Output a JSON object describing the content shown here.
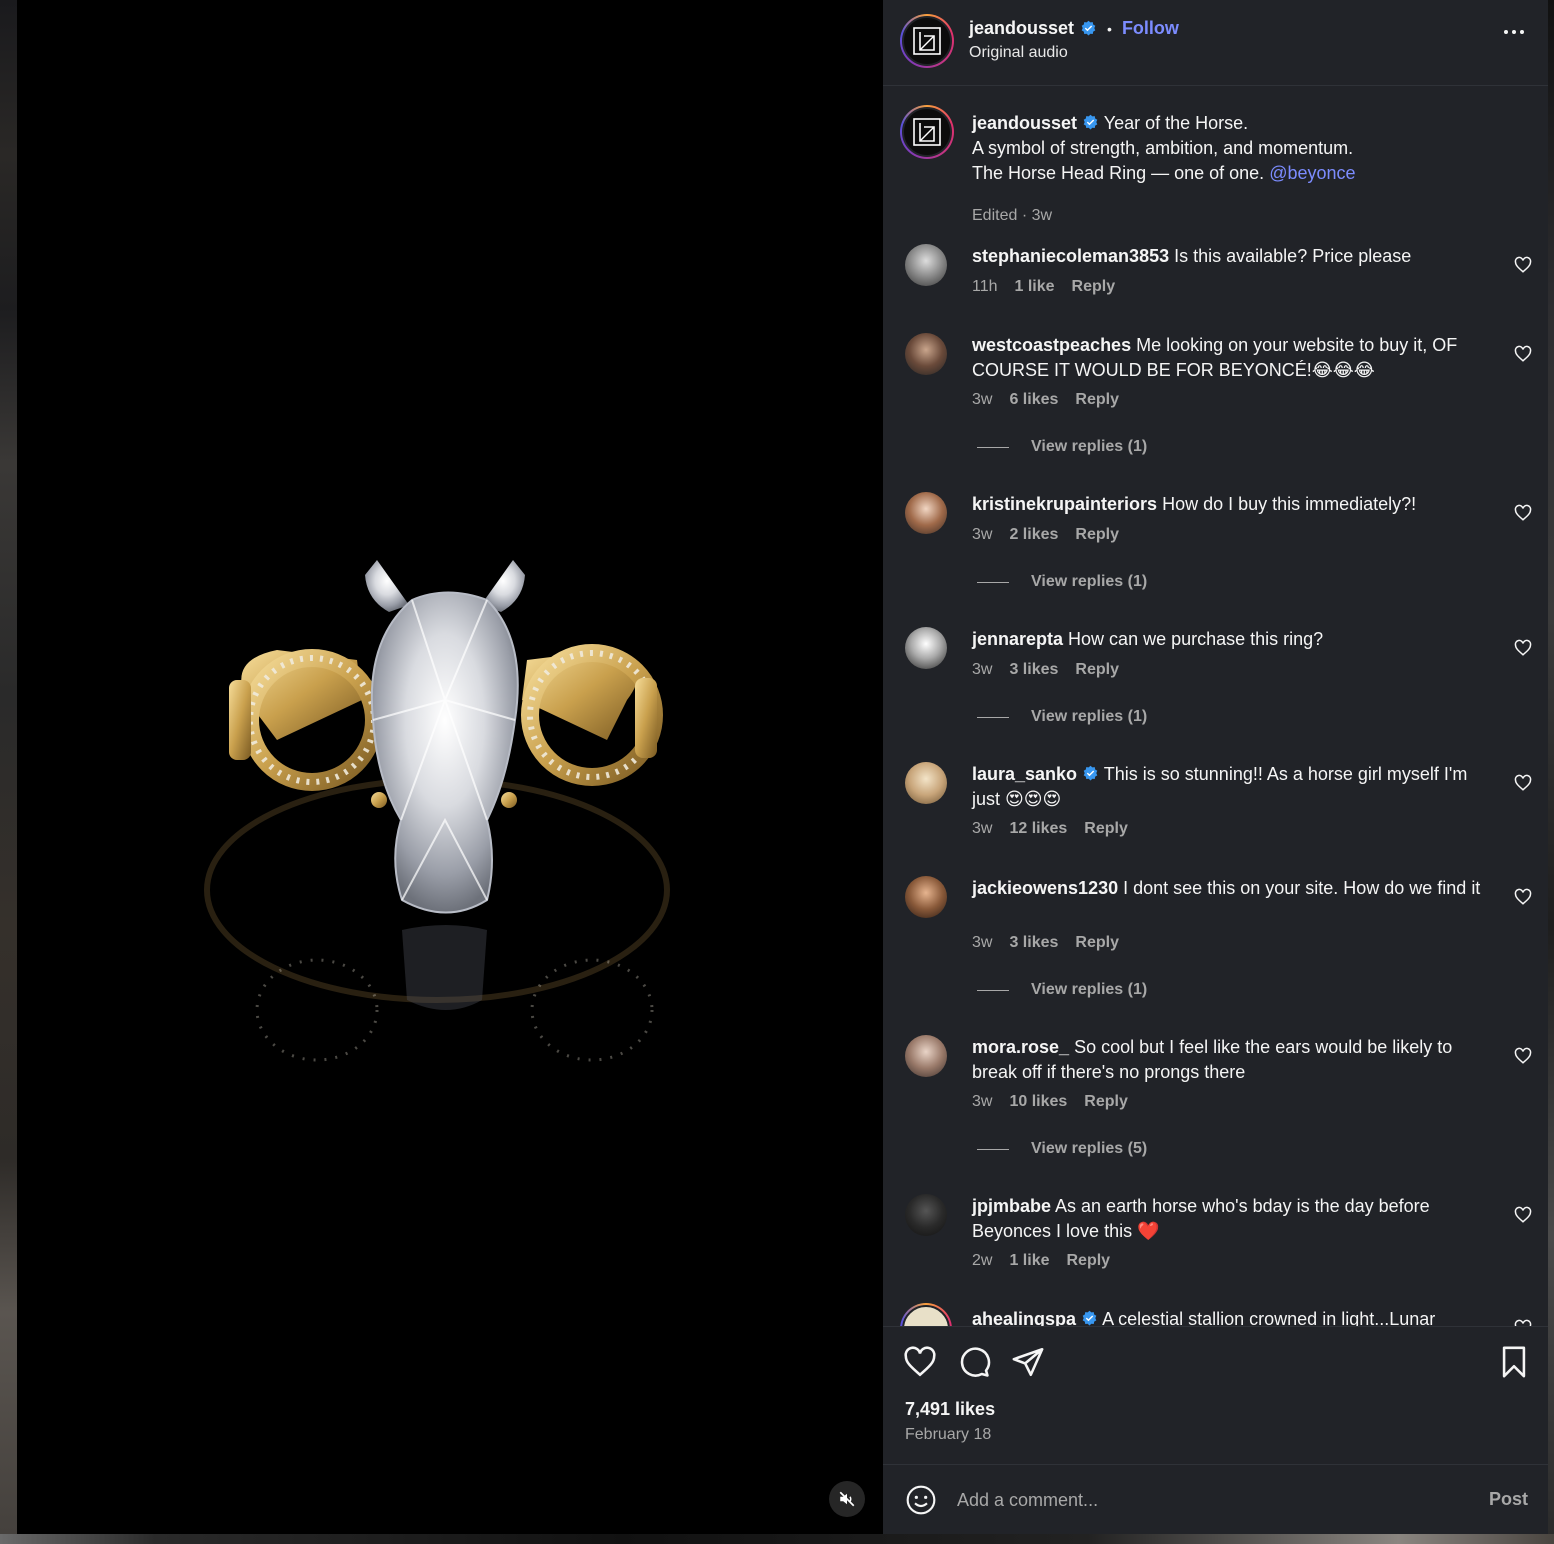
{
  "header": {
    "username": "jeandousset",
    "separator": "•",
    "follow_label": "Follow",
    "audio": "Original audio"
  },
  "caption": {
    "username": "jeandousset",
    "line1": "Year of the Horse.",
    "line2": "A symbol of strength, ambition, and momentum.",
    "line3": "The Horse Head Ring — one of one.",
    "mention": "@beyonce",
    "meta": "Edited · 3w"
  },
  "comments": [
    {
      "username": "stephaniecoleman3853",
      "text": "Is this available? Price please",
      "time": "11h",
      "likes": "1 like",
      "reply": "Reply"
    },
    {
      "username": "westcoastpeaches",
      "text": "Me looking on your website to buy it, OF COURSE IT WOULD BE FOR BEYONCÉ!😂😂😂",
      "time": "3w",
      "likes": "6 likes",
      "reply": "Reply",
      "view_replies": "View replies (1)"
    },
    {
      "username": "kristinekrupainteriors",
      "text": "How do I buy this immediately?!",
      "time": "3w",
      "likes": "2 likes",
      "reply": "Reply",
      "view_replies": "View replies (1)"
    },
    {
      "username": "jennarepta",
      "text": "How can we purchase this ring?",
      "time": "3w",
      "likes": "3 likes",
      "reply": "Reply",
      "view_replies": "View replies (1)"
    },
    {
      "username": "laura_sanko",
      "text": "This is so stunning!! As a horse girl myself I'm just 😍😍😍",
      "time": "3w",
      "likes": "12 likes",
      "reply": "Reply"
    },
    {
      "username": "jackieowens1230",
      "text": "I dont see this on your site. How do we find it",
      "time": "3w",
      "likes": "3 likes",
      "reply": "Reply",
      "view_replies": "View replies (1)"
    },
    {
      "username": "mora.rose_",
      "text": "So cool but I feel like the ears would be likely to break off if there's no prongs there",
      "time": "3w",
      "likes": "10 likes",
      "reply": "Reply",
      "view_replies": "View replies (5)"
    },
    {
      "username": "jpjmbabe",
      "text": "As an earth horse who's bday is the day before Beyonces I love this ❤️",
      "time": "2w",
      "likes": "1 like",
      "reply": "Reply"
    },
    {
      "username": "ahealingspa",
      "text": "A celestial stallion crowned in light...Lunar"
    }
  ],
  "actions": {
    "likes": "7,491 likes",
    "date": "February 18"
  },
  "composer": {
    "placeholder": "Add a comment...",
    "post_label": "Post"
  },
  "colors": {
    "panel_bg": "#212328",
    "link": "#7c8cff",
    "verified": "#3897f0",
    "muted_text": "#a8a8a8"
  },
  "icons": [
    "more-icon",
    "verified-icon",
    "heart-icon",
    "comment-icon",
    "share-icon",
    "bookmark-icon",
    "emoji-icon",
    "mute-icon"
  ]
}
